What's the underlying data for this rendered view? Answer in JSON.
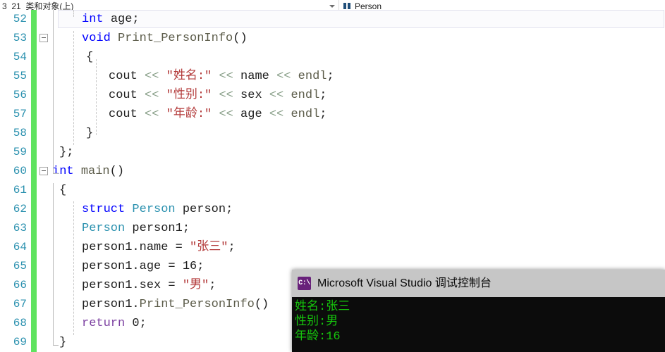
{
  "navbar": {
    "scope_label": "3_21_类和对象(上)",
    "member_label": "Person",
    "caret_icon": "chevron-down-icon",
    "member_icon": "struct-member-icon"
  },
  "editor": {
    "first_line_number": 52,
    "current_line_number": 52,
    "change_bar_color": "#5fe35f",
    "lines": [
      {
        "number": "52",
        "fold": false,
        "current": true,
        "indent": 42,
        "tokens": [
          {
            "t": "int",
            "c": "kw"
          },
          {
            "t": " ",
            "c": "punct"
          },
          {
            "t": "age",
            "c": "id"
          },
          {
            "t": ";",
            "c": "punct"
          }
        ]
      },
      {
        "number": "53",
        "fold": true,
        "current": false,
        "indent": 42,
        "tokens": [
          {
            "t": "void",
            "c": "kw"
          },
          {
            "t": " ",
            "c": "punct"
          },
          {
            "t": "Print_PersonInfo",
            "c": "fn"
          },
          {
            "t": "()",
            "c": "punct"
          }
        ]
      },
      {
        "number": "54",
        "fold": false,
        "current": false,
        "indent": 48,
        "tokens": [
          {
            "t": "{",
            "c": "punct"
          }
        ]
      },
      {
        "number": "55",
        "fold": false,
        "current": false,
        "indent": 80,
        "tokens": [
          {
            "t": "cout ",
            "c": "id"
          },
          {
            "t": "<<",
            "c": "op"
          },
          {
            "t": " ",
            "c": "punct"
          },
          {
            "t": "\"姓名:\"",
            "c": "str"
          },
          {
            "t": " ",
            "c": "punct"
          },
          {
            "t": "<<",
            "c": "op"
          },
          {
            "t": " name ",
            "c": "id"
          },
          {
            "t": "<<",
            "c": "op"
          },
          {
            "t": " ",
            "c": "punct"
          },
          {
            "t": "endl",
            "c": "fn"
          },
          {
            "t": ";",
            "c": "punct"
          }
        ]
      },
      {
        "number": "56",
        "fold": false,
        "current": false,
        "indent": 80,
        "tokens": [
          {
            "t": "cout ",
            "c": "id"
          },
          {
            "t": "<<",
            "c": "op"
          },
          {
            "t": " ",
            "c": "punct"
          },
          {
            "t": "\"性别:\"",
            "c": "str"
          },
          {
            "t": " ",
            "c": "punct"
          },
          {
            "t": "<<",
            "c": "op"
          },
          {
            "t": " sex ",
            "c": "id"
          },
          {
            "t": "<<",
            "c": "op"
          },
          {
            "t": " ",
            "c": "punct"
          },
          {
            "t": "endl",
            "c": "fn"
          },
          {
            "t": ";",
            "c": "punct"
          }
        ]
      },
      {
        "number": "57",
        "fold": false,
        "current": false,
        "indent": 80,
        "tokens": [
          {
            "t": "cout ",
            "c": "id"
          },
          {
            "t": "<<",
            "c": "op"
          },
          {
            "t": " ",
            "c": "punct"
          },
          {
            "t": "\"年龄:\"",
            "c": "str"
          },
          {
            "t": " ",
            "c": "punct"
          },
          {
            "t": "<<",
            "c": "op"
          },
          {
            "t": " age ",
            "c": "id"
          },
          {
            "t": "<<",
            "c": "op"
          },
          {
            "t": " ",
            "c": "punct"
          },
          {
            "t": "endl",
            "c": "fn"
          },
          {
            "t": ";",
            "c": "punct"
          }
        ]
      },
      {
        "number": "58",
        "fold": false,
        "current": false,
        "indent": 48,
        "tokens": [
          {
            "t": "}",
            "c": "punct"
          }
        ]
      },
      {
        "number": "59",
        "fold": false,
        "current": false,
        "indent": 10,
        "tokens": [
          {
            "t": "};",
            "c": "punct"
          }
        ]
      },
      {
        "number": "60",
        "fold": true,
        "current": false,
        "indent": 0,
        "tokens": [
          {
            "t": "int",
            "c": "kw"
          },
          {
            "t": " ",
            "c": "punct"
          },
          {
            "t": "main",
            "c": "fn"
          },
          {
            "t": "()",
            "c": "punct"
          }
        ]
      },
      {
        "number": "61",
        "fold": false,
        "current": false,
        "indent": 10,
        "tokens": [
          {
            "t": "{",
            "c": "punct"
          }
        ]
      },
      {
        "number": "62",
        "fold": false,
        "current": false,
        "indent": 42,
        "tokens": [
          {
            "t": "struct",
            "c": "kw"
          },
          {
            "t": " ",
            "c": "punct"
          },
          {
            "t": "Person",
            "c": "type"
          },
          {
            "t": " person",
            "c": "id"
          },
          {
            "t": ";",
            "c": "punct"
          }
        ]
      },
      {
        "number": "63",
        "fold": false,
        "current": false,
        "indent": 42,
        "tokens": [
          {
            "t": "Person",
            "c": "type"
          },
          {
            "t": " person1",
            "c": "id"
          },
          {
            "t": ";",
            "c": "punct"
          }
        ]
      },
      {
        "number": "64",
        "fold": false,
        "current": false,
        "indent": 42,
        "tokens": [
          {
            "t": "person1",
            "c": "id"
          },
          {
            "t": ".",
            "c": "punct"
          },
          {
            "t": "name",
            "c": "id"
          },
          {
            "t": " = ",
            "c": "punct"
          },
          {
            "t": "\"张三\"",
            "c": "str"
          },
          {
            "t": ";",
            "c": "punct"
          }
        ]
      },
      {
        "number": "65",
        "fold": false,
        "current": false,
        "indent": 42,
        "tokens": [
          {
            "t": "person1",
            "c": "id"
          },
          {
            "t": ".",
            "c": "punct"
          },
          {
            "t": "age",
            "c": "id"
          },
          {
            "t": " = ",
            "c": "punct"
          },
          {
            "t": "16",
            "c": "num"
          },
          {
            "t": ";",
            "c": "punct"
          }
        ]
      },
      {
        "number": "66",
        "fold": false,
        "current": false,
        "indent": 42,
        "tokens": [
          {
            "t": "person1",
            "c": "id"
          },
          {
            "t": ".",
            "c": "punct"
          },
          {
            "t": "sex",
            "c": "id"
          },
          {
            "t": " = ",
            "c": "punct"
          },
          {
            "t": "\"男\"",
            "c": "str"
          },
          {
            "t": ";",
            "c": "punct"
          }
        ]
      },
      {
        "number": "67",
        "fold": false,
        "current": false,
        "indent": 42,
        "tokens": [
          {
            "t": "person1",
            "c": "id"
          },
          {
            "t": ".",
            "c": "punct"
          },
          {
            "t": "Print_PersonInfo",
            "c": "fn"
          },
          {
            "t": "()",
            "c": "punct"
          }
        ]
      },
      {
        "number": "68",
        "fold": false,
        "current": false,
        "indent": 42,
        "tokens": [
          {
            "t": "return",
            "c": "kw2"
          },
          {
            "t": " ",
            "c": "punct"
          },
          {
            "t": "0",
            "c": "num"
          },
          {
            "t": ";",
            "c": "punct"
          }
        ]
      },
      {
        "number": "69",
        "fold": false,
        "current": false,
        "indent": 10,
        "tokens": [
          {
            "t": "}",
            "c": "punct"
          }
        ]
      }
    ]
  },
  "console": {
    "title": "Microsoft Visual Studio 调试控制台",
    "icon_text": "C:\\",
    "icon_name": "console-app-icon",
    "background": "#0c0c0c",
    "text_color": "#16c60c",
    "output_lines": [
      "姓名:张三",
      "性别:男",
      "年龄:16"
    ]
  }
}
